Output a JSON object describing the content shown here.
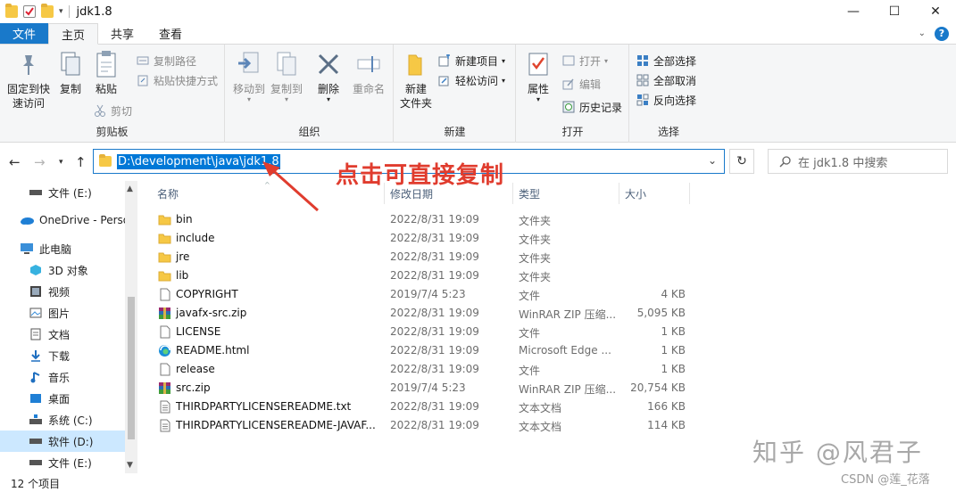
{
  "window": {
    "title": "jdk1.8",
    "controls": {
      "minimize": "—",
      "maximize": "☐",
      "close": "✕"
    }
  },
  "tabs": [
    {
      "label": "文件"
    },
    {
      "label": "主页"
    },
    {
      "label": "共享"
    },
    {
      "label": "查看"
    }
  ],
  "ribbon": {
    "clipboard": {
      "label": "剪贴板",
      "pin": "固定到快速访问",
      "pin_line1": "固定到快",
      "pin_line2": "速访问",
      "copy": "复制",
      "paste": "粘贴",
      "copy_path": "复制路径",
      "paste_shortcut": "粘贴快捷方式",
      "cut": "剪切"
    },
    "organize": {
      "label": "组织",
      "move_to": "移动到",
      "copy_to": "复制到",
      "delete": "删除",
      "rename": "重命名"
    },
    "new": {
      "label": "新建",
      "new_folder_line1": "新建",
      "new_folder_line2": "文件夹",
      "new_item": "新建项目",
      "easy_access": "轻松访问"
    },
    "open": {
      "label": "打开",
      "properties": "属性",
      "open": "打开",
      "edit": "编辑",
      "history": "历史记录"
    },
    "select": {
      "label": "选择",
      "select_all": "全部选择",
      "select_none": "全部取消",
      "invert": "反向选择"
    }
  },
  "address": {
    "path": "D:\\development\\java\\jdk1.8",
    "search_placeholder": "在 jdk1.8 中搜索"
  },
  "annotation": "点击可直接复制",
  "nav_pane": [
    {
      "label": "文件 (E:)",
      "icon": "drive-icon"
    },
    {
      "label": "OneDrive - Perso",
      "icon": "cloud-icon"
    },
    {
      "label": "此电脑",
      "icon": "computer-icon"
    },
    {
      "label": "3D 对象",
      "icon": "cube-icon"
    },
    {
      "label": "视频",
      "icon": "video-icon"
    },
    {
      "label": "图片",
      "icon": "picture-icon"
    },
    {
      "label": "文档",
      "icon": "document-icon"
    },
    {
      "label": "下载",
      "icon": "download-icon"
    },
    {
      "label": "音乐",
      "icon": "music-icon"
    },
    {
      "label": "桌面",
      "icon": "desktop-icon"
    },
    {
      "label": "系统 (C:)",
      "icon": "drive-icon"
    },
    {
      "label": "软件 (D:)",
      "icon": "drive-icon",
      "selected": true
    },
    {
      "label": "文件 (E:)",
      "icon": "drive-icon"
    }
  ],
  "columns": {
    "name": "名称",
    "date": "修改日期",
    "type": "类型",
    "size": "大小"
  },
  "files": [
    {
      "name": "bin",
      "date": "2022/8/31 19:09",
      "type": "文件夹",
      "size": "",
      "kind": "folder"
    },
    {
      "name": "include",
      "date": "2022/8/31 19:09",
      "type": "文件夹",
      "size": "",
      "kind": "folder"
    },
    {
      "name": "jre",
      "date": "2022/8/31 19:09",
      "type": "文件夹",
      "size": "",
      "kind": "folder"
    },
    {
      "name": "lib",
      "date": "2022/8/31 19:09",
      "type": "文件夹",
      "size": "",
      "kind": "folder"
    },
    {
      "name": "COPYRIGHT",
      "date": "2019/7/4 5:23",
      "type": "文件",
      "size": "4 KB",
      "kind": "file"
    },
    {
      "name": "javafx-src.zip",
      "date": "2022/8/31 19:09",
      "type": "WinRAR ZIP 压缩...",
      "size": "5,095 KB",
      "kind": "zip"
    },
    {
      "name": "LICENSE",
      "date": "2022/8/31 19:09",
      "type": "文件",
      "size": "1 KB",
      "kind": "file"
    },
    {
      "name": "README.html",
      "date": "2022/8/31 19:09",
      "type": "Microsoft Edge ...",
      "size": "1 KB",
      "kind": "edge"
    },
    {
      "name": "release",
      "date": "2022/8/31 19:09",
      "type": "文件",
      "size": "1 KB",
      "kind": "file"
    },
    {
      "name": "src.zip",
      "date": "2019/7/4 5:23",
      "type": "WinRAR ZIP 压缩...",
      "size": "20,754 KB",
      "kind": "zip"
    },
    {
      "name": "THIRDPARTYLICENSEREADME.txt",
      "date": "2022/8/31 19:09",
      "type": "文本文档",
      "size": "166 KB",
      "kind": "txt"
    },
    {
      "name": "THIRDPARTYLICENSEREADME-JAVAF...",
      "date": "2022/8/31 19:09",
      "type": "文本文档",
      "size": "114 KB",
      "kind": "txt"
    }
  ],
  "status": "12 个项目",
  "watermark": {
    "zhihu": "知乎 @风君子",
    "csdn": "CSDN @莲_花落"
  },
  "colors": {
    "accent": "#1979ca",
    "selection": "#0078d7",
    "annotation": "#e03c2e",
    "folder": "#f6c845"
  }
}
